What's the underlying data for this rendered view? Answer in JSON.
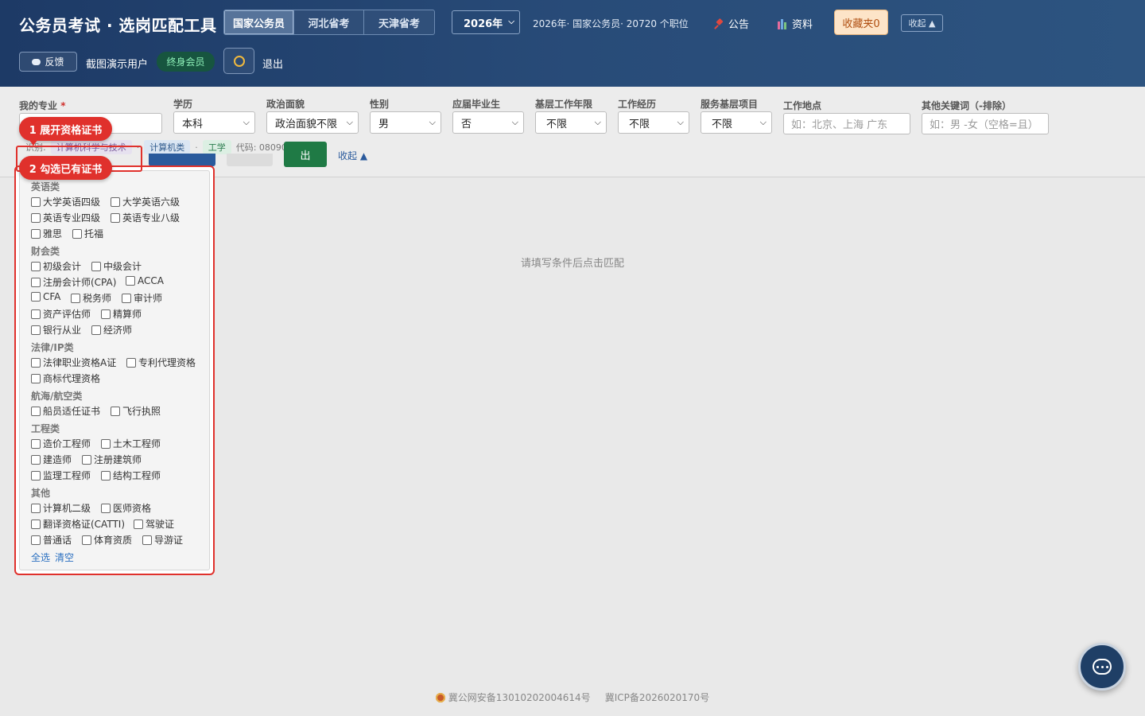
{
  "header": {
    "title": "公务员考试 · 选岗匹配工具",
    "tabs": [
      "国家公务员",
      "河北省考",
      "天津省考"
    ],
    "year": "2026年",
    "info": "2026年· 国家公务员· 20720 个职位",
    "notice_label": "公告",
    "resources_label": "资料",
    "favorites_label": "收藏夹0",
    "collapse_label": "收起 ▲",
    "feedback_label": "反馈",
    "username": "截图演示用户",
    "member_badge": "终身会员",
    "logout_label": "退出"
  },
  "filters": {
    "major_label": "我的专业",
    "major_required": "*",
    "education_label": "学历",
    "education_value": "本科",
    "political_label": "政治面貌",
    "political_value": "政治面貌不限",
    "gender_label": "性别",
    "gender_value": "男",
    "fresh_grad_label": "应届毕业生",
    "fresh_grad_value": "否",
    "grassroots_years_label": "基层工作年限",
    "grassroots_years_value": "不限",
    "work_exp_label": "工作经历",
    "work_exp_value": "不限",
    "service_project_label": "服务基层项目",
    "service_project_value": "不限",
    "location_label": "工作地点",
    "location_placeholder": "如：北京、上海 广东",
    "keywords_label": "其他关键词（-排除）",
    "keywords_placeholder": "如：男 -女（空格=且）",
    "recognized_prefix": "识别:",
    "recognized_major": "计算机科学与技术",
    "recognized_category": "计算机类",
    "recognized_discipline": "工学",
    "recognized_code": "代码: 080901",
    "match_label": "出",
    "collapse_link": "收起 ▲"
  },
  "main": {
    "empty_message": "请填写条件后点击匹配"
  },
  "certificates": {
    "groups": [
      {
        "name": "英语类",
        "items": [
          "大学英语四级",
          "大学英语六级",
          "英语专业四级",
          "英语专业八级",
          "雅思",
          "托福"
        ]
      },
      {
        "name": "财会类",
        "items": [
          "初级会计",
          "中级会计",
          "注册会计师(CPA)",
          "ACCA",
          "CFA",
          "税务师",
          "审计师",
          "资产评估师",
          "精算师",
          "银行从业",
          "经济师"
        ]
      },
      {
        "name": "法律/IP类",
        "items": [
          "法律职业资格A证",
          "专利代理资格",
          "商标代理资格"
        ]
      },
      {
        "name": "航海/航空类",
        "items": [
          "船员适任证书",
          "飞行执照"
        ]
      },
      {
        "name": "工程类",
        "items": [
          "造价工程师",
          "土木工程师",
          "建造师",
          "注册建筑师",
          "监理工程师",
          "结构工程师"
        ]
      },
      {
        "name": "其他",
        "items": [
          "计算机二级",
          "医师资格",
          "翻译资格证(CATTI)",
          "驾驶证",
          "普通话",
          "体育资质",
          "导游证"
        ]
      }
    ],
    "select_all": "全选",
    "clear": "清空"
  },
  "callouts": {
    "step1": "1 展开资格证书",
    "step2": "2 勾选已有证书"
  },
  "footer": {
    "police_record": "冀公网安备13010202004614号",
    "icp_record": "冀ICP备2026020170号"
  },
  "colors": {
    "header_bg": "#1d3a66",
    "accent_red": "#e0312c",
    "match_green": "#1f7a45",
    "link_blue": "#2a6fc0"
  }
}
